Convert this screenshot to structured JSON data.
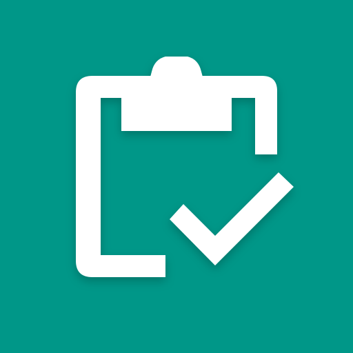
{
  "app_icon": {
    "name": "clipboard-check-icon",
    "background_color": "#009788",
    "foreground_color": "#ffffff"
  }
}
